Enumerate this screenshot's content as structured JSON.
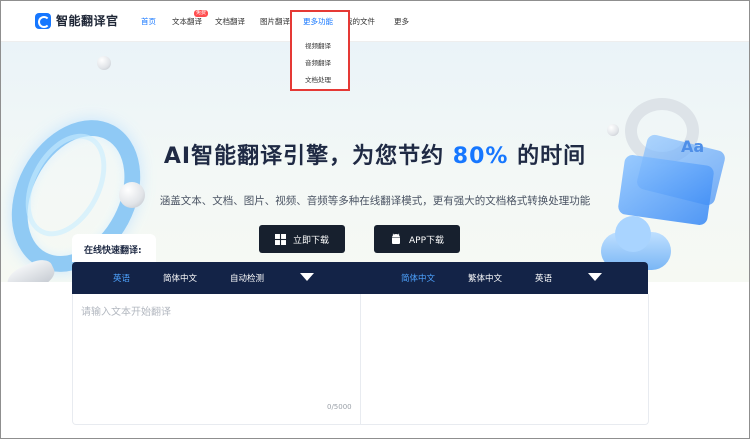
{
  "brand": {
    "name": "智能翻译官"
  },
  "nav": {
    "home": "首页",
    "text_translate": "文本翻译",
    "text_badge": "免费",
    "doc_translate": "文档翻译",
    "image_translate": "图片翻译",
    "more_features": "更多功能",
    "my_files": "我的文件",
    "more": "更多"
  },
  "dropdown": {
    "items": [
      "视频翻译",
      "音频翻译",
      "文档处理"
    ]
  },
  "hero": {
    "headline_prefix": "AI智能翻译引擎，为您节约",
    "headline_pct": "80%",
    "headline_suffix": "的时间",
    "subline": "涵盖文本、文档、图片、视频、音频等多种在线翻译模式，更有强大的文档格式转换处理功能",
    "download_button": "立即下载",
    "app_button": "APP下载"
  },
  "translator": {
    "tab_label": "在线快速翻译:",
    "source_langs": [
      "英语",
      "简体中文",
      "自动检测"
    ],
    "target_langs": [
      "简体中文",
      "繁体中文",
      "英语"
    ],
    "placeholder": "请输入文本开始翻译",
    "char_count": "0/5000"
  },
  "colors": {
    "accent": "#1677ff",
    "lang_bar": "#132347",
    "button_dark": "#17202e",
    "highlight_border": "#e53935"
  }
}
